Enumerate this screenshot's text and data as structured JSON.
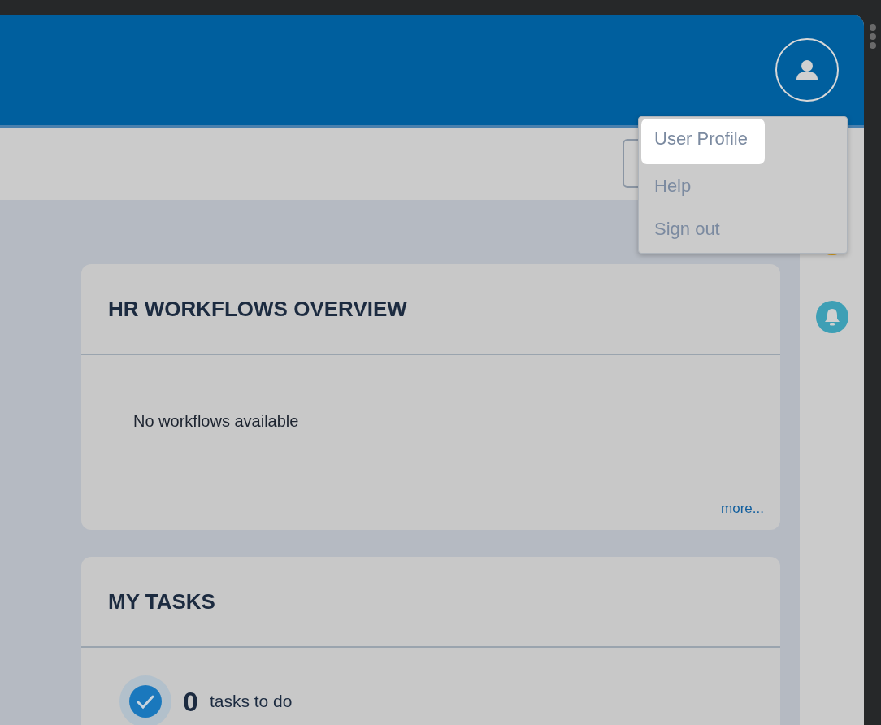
{
  "user_menu": {
    "items": [
      {
        "label": "User Profile",
        "selected": true
      },
      {
        "label": "Help",
        "selected": false
      },
      {
        "label": "Sign out",
        "selected": false
      }
    ]
  },
  "workflows_card": {
    "title": "HR WORKFLOWS OVERVIEW",
    "empty_text": "No workflows available",
    "more_link": "more..."
  },
  "tasks_card": {
    "title": "MY TASKS",
    "count": "0",
    "count_label": "tasks to do"
  }
}
